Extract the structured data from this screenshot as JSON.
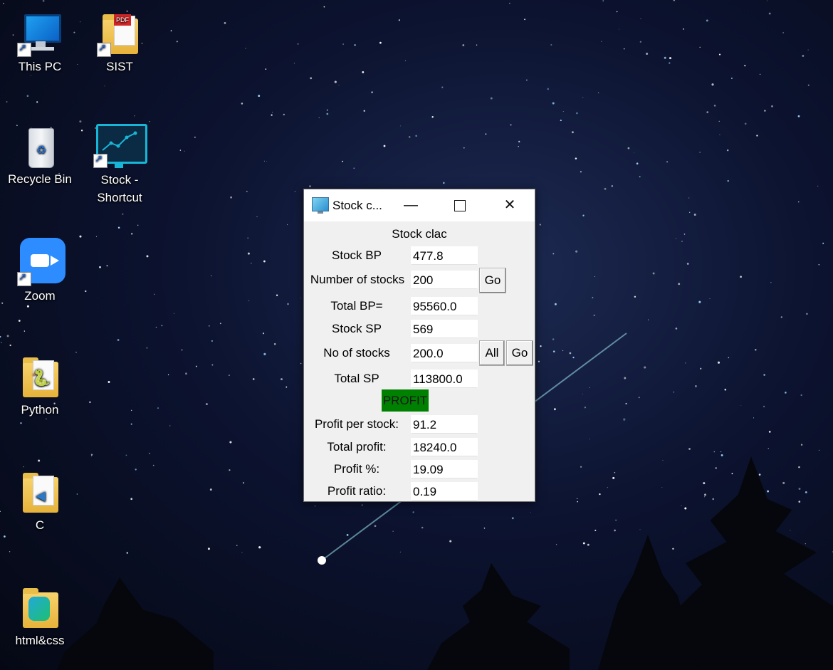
{
  "desktop": {
    "icons": [
      {
        "label": "This PC"
      },
      {
        "label": "SIST"
      },
      {
        "label": "Recycle Bin"
      },
      {
        "label": "Stock - Shortcut"
      },
      {
        "label": "Zoom"
      },
      {
        "label": "Python"
      },
      {
        "label": "C"
      },
      {
        "label": "html&css"
      }
    ]
  },
  "window": {
    "title": "Stock c...",
    "heading": "Stock clac",
    "rows": {
      "stock_bp": {
        "label": "Stock BP",
        "value": "477.8"
      },
      "number_of_stocks": {
        "label": "Number of stocks",
        "value": "200"
      },
      "total_bp": {
        "label": "Total BP=",
        "value": "95560.0"
      },
      "stock_sp": {
        "label": "Stock SP",
        "value": "569"
      },
      "no_of_stocks": {
        "label": "No of stocks",
        "value": "200.0"
      },
      "total_sp": {
        "label": "Total SP",
        "value": "113800.0"
      },
      "profit_per_stock": {
        "label": "Profit per stock:",
        "value": "91.2"
      },
      "total_profit": {
        "label": "Total profit:",
        "value": "18240.0"
      },
      "profit_pct": {
        "label": "Profit %:",
        "value": "19.09"
      },
      "profit_ratio": {
        "label": "Profit ratio:",
        "value": "0.19"
      }
    },
    "buttons": {
      "go1": "Go",
      "all": "All",
      "go2": "Go"
    },
    "status": "PROFIT",
    "status_color": "#008000"
  }
}
